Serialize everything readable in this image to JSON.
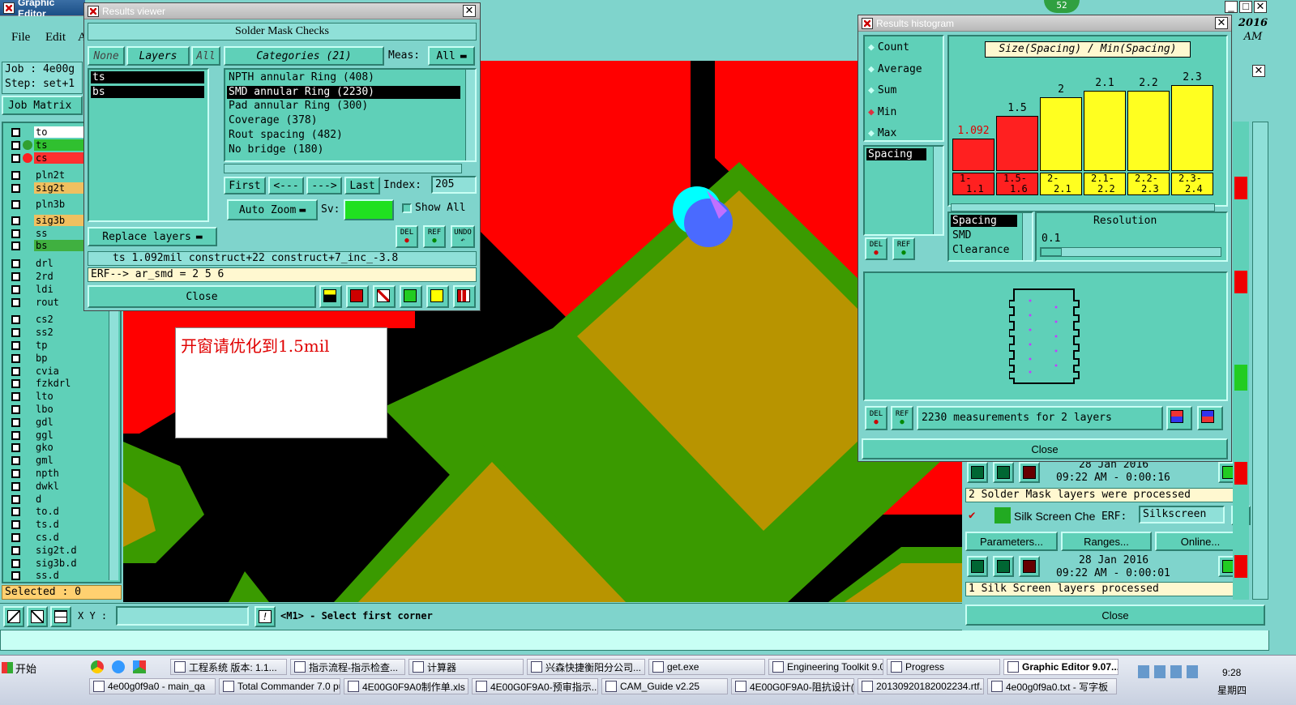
{
  "main_window": {
    "title": "Graphic Editor",
    "menu": [
      "File",
      "Edit",
      "A"
    ],
    "job_label": "Job : 4e00g",
    "step_label": "Step: set+1",
    "job_matrix_button": "Job Matrix",
    "clock_top": "2016",
    "clock_am": "AM",
    "layers": [
      "to",
      "ts",
      "cs",
      "pln2t",
      "sig2t",
      "pln3b",
      "sig3b",
      "ss",
      "bs",
      "drl",
      "2rd",
      "ldi",
      "rout",
      "cs2",
      "ss2",
      "tp",
      "bp",
      "cvia",
      "fzkdrl",
      "lto",
      "lbo",
      "gdl",
      "ggl",
      "gko",
      "gml",
      "npth",
      "dwkl",
      "d",
      "to.d",
      "ts.d",
      "cs.d",
      "sig2t.d",
      "sig3b.d",
      "ss.d"
    ],
    "selected_label": "Selected : 0",
    "xy_label": "X Y :",
    "xy_value": "",
    "prompt_text": "<M1> - Select first corner",
    "badge_number": "52",
    "annotation_text": "开窗请优化到1.5mil"
  },
  "results_viewer": {
    "title": "Results viewer",
    "header": "Solder Mask Checks",
    "none_btn": "None",
    "layers_btn": "Layers",
    "all_btn": "All",
    "layer_list": [
      "ts",
      "bs"
    ],
    "categories_btn": "Categories (21)",
    "meas_label": "Meas:",
    "meas_value": "All",
    "categories": [
      "NPTH annular Ring (408)",
      "SMD annular Ring (2230)",
      "Pad annular Ring (300)",
      "Coverage (378)",
      "Rout spacing (482)",
      "No bridge (180)"
    ],
    "selected_category_index": 1,
    "first_btn": "First",
    "prev_btn": "<---",
    "next_btn": "--->",
    "last_btn": "Last",
    "index_label": "Index:",
    "index_value": "205",
    "auto_zoom": "Auto Zoom",
    "sv_label": "Sv:",
    "show_all": "Show All",
    "replace_layers": "Replace layers",
    "del_label": "DEL",
    "ref_label": "REF",
    "undo_label": "UNDO",
    "status_line": "ts 1.092mil   construct+22   construct+7_inc_-3.8",
    "erf_line": "ERF--> ar_smd = 2 5 6",
    "close": "Close"
  },
  "histogram": {
    "title": "Results histogram",
    "modes": [
      "Count",
      "Average",
      "Sum",
      "Min",
      "Max"
    ],
    "selected_mode": "Min",
    "metric_title": "Size(Spacing) / Min(Spacing)",
    "metric_list": [
      "Spacing"
    ],
    "bars": [
      {
        "value_label": "1.092",
        "range": [
          "1-",
          "1.1"
        ],
        "height": 0.35,
        "color": "#ff2020"
      },
      {
        "value_label": "1.5",
        "range": [
          "1.5-",
          "1.6"
        ],
        "height": 0.6,
        "color": "#ff2020"
      },
      {
        "value_label": "2",
        "range": [
          "2-",
          "2.1"
        ],
        "height": 0.8,
        "color": "#ffff20"
      },
      {
        "value_label": "2.1",
        "range": [
          "2.1-",
          "2.2"
        ],
        "height": 0.87,
        "color": "#ffff20"
      },
      {
        "value_label": "2.2",
        "range": [
          "2.2-",
          "2.3"
        ],
        "height": 0.87,
        "color": "#ffff20"
      },
      {
        "value_label": "2.3",
        "range": [
          "2.3-",
          "2.4"
        ],
        "height": 0.93,
        "color": "#ffff20"
      }
    ],
    "spacing_list": [
      "Spacing",
      "SMD",
      "Clearance"
    ],
    "resolution_label": "Resolution",
    "resolution_value": "0.1",
    "measurements": "2230 measurements for 2 layers",
    "close": "Close"
  },
  "checklist": {
    "entries": [
      {
        "date": "28 Jan 2016",
        "time": "09:22 AM - 0:00:16",
        "result": "2 Solder Mask layers were processed"
      },
      {
        "date": "28 Jan 2016",
        "time": "09:22 AM - 0:00:01",
        "result": "1 Silk Screen layers processed"
      }
    ],
    "silk_label": "Silk Screen Che",
    "erf_label": "ERF:",
    "erf_value": "Silkscreen",
    "help": "?",
    "parameters": "Parameters...",
    "ranges": "Ranges...",
    "online": "Online...",
    "close": "Close"
  },
  "taskbar": {
    "start": "开始",
    "row1": [
      "工程系统  版本: 1.1...",
      "指示流程-指示检查...",
      "计算器",
      "兴森快捷衡阳分公司...",
      "get.exe",
      "Engineering Toolkit 9.0...",
      "Progress",
      "Graphic Editor 9.07..."
    ],
    "row2": [
      "4e00g0f9a0 - main_qa",
      "Total Commander 7.0 pu...",
      "4E00G0F9A0制作单.xls ...",
      "4E00G0F9A0-预审指示...",
      "CAM_Guide v2.25",
      "4E00G0F9A0-阻抗设计(...",
      "20130920182002234.rtf...",
      "4e00g0f9a0.txt - 写字板"
    ],
    "time": "9:28",
    "day": "星期四"
  }
}
